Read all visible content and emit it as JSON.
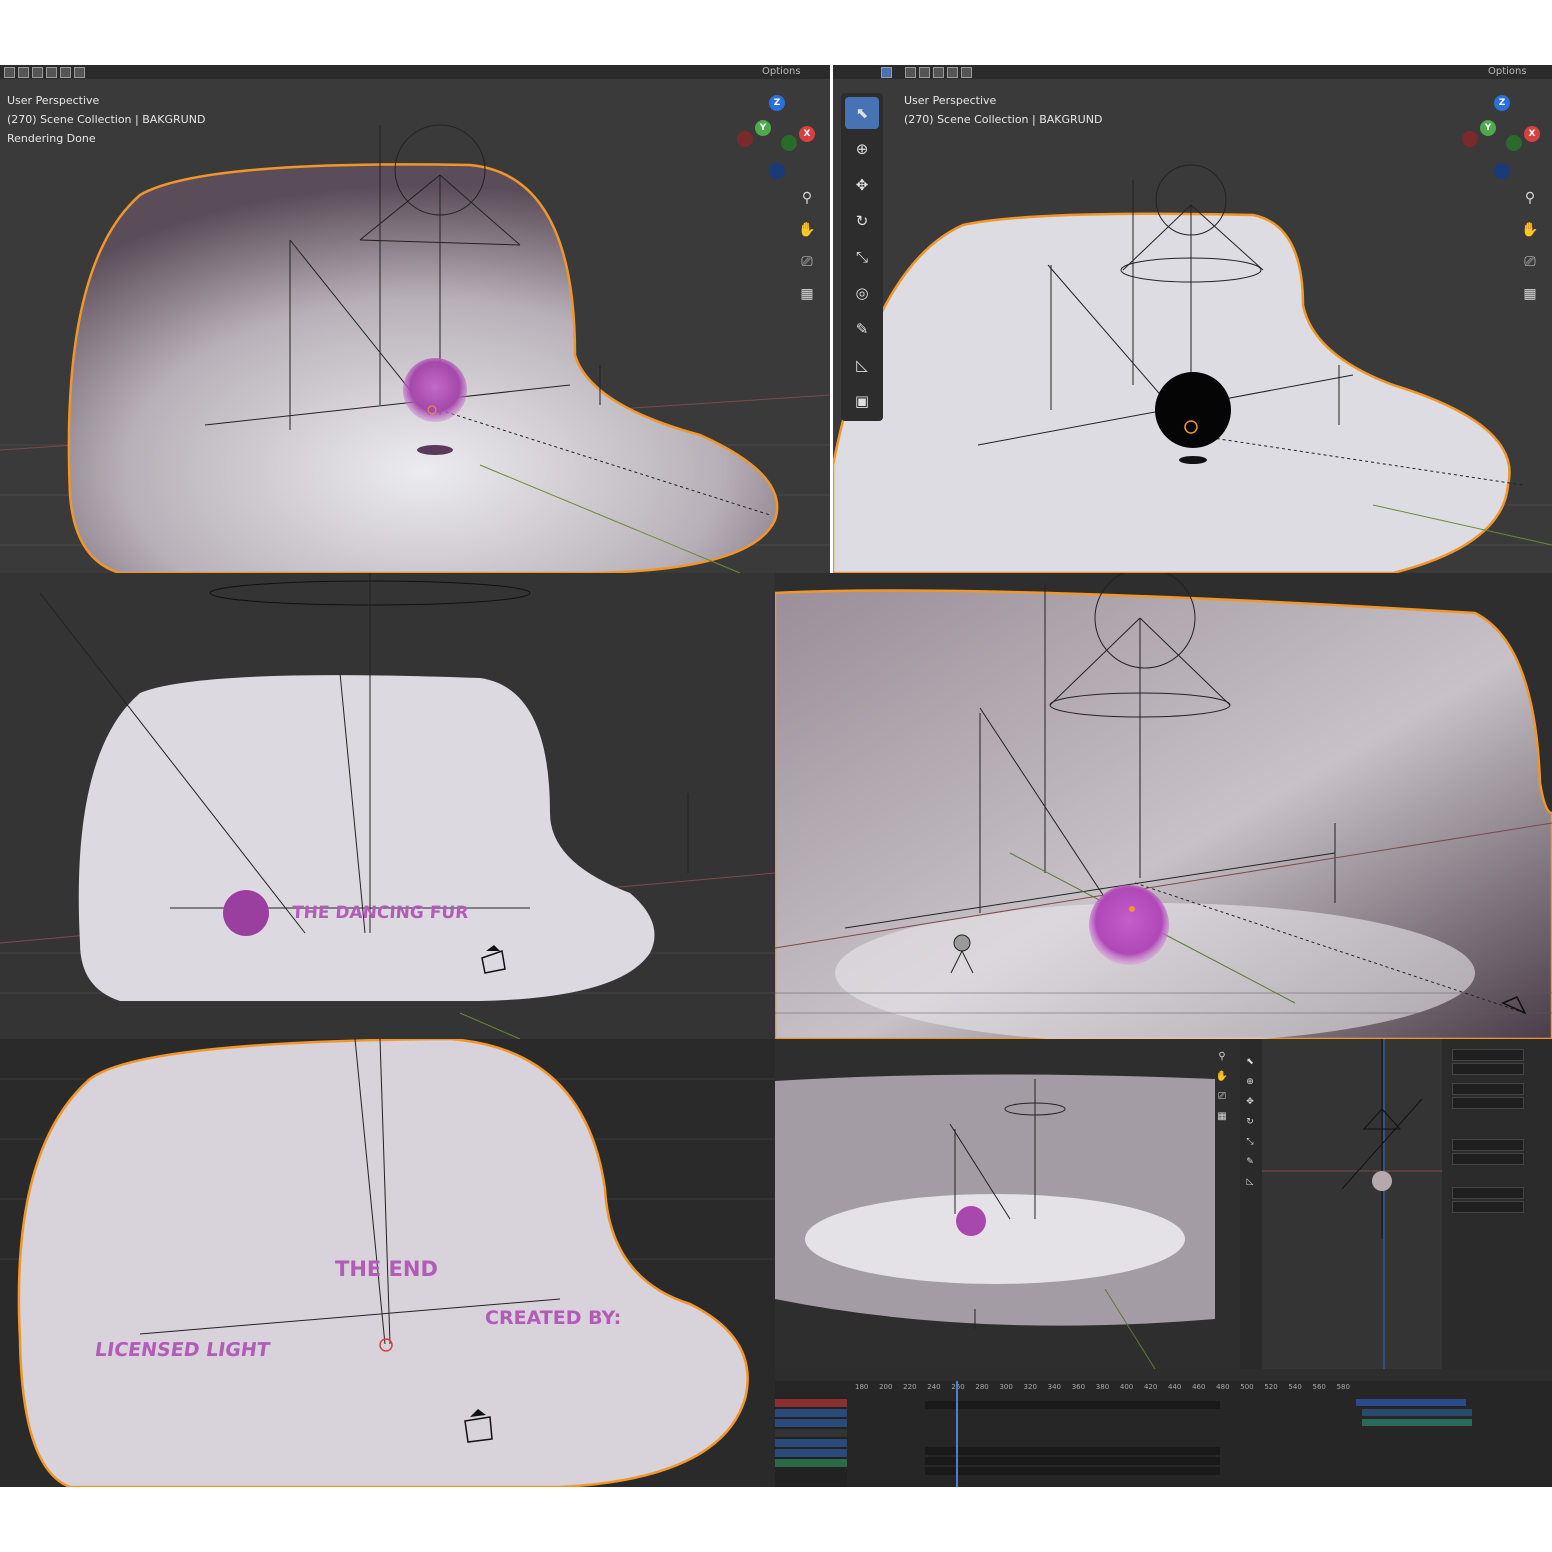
{
  "panel_top_left": {
    "options_label": "Options",
    "overlay_line1": "User Perspective",
    "overlay_line2": "(270) Scene Collection | BAKGRUND",
    "overlay_line3": "Rendering Done"
  },
  "panel_top_right": {
    "options_label": "Options",
    "overlay_line1": "User Perspective",
    "overlay_line2": "(270) Scene Collection | BAKGRUND"
  },
  "panel_mid_left": {
    "scene_text": "THE DANCING FUR"
  },
  "panel_bottom_left": {
    "scene_text_1": "THE END",
    "scene_text_2": "LICENSED LIGHT",
    "scene_text_3": "CREATED BY:"
  },
  "panel_bottom_right": {
    "timeline_frames": [
      "180",
      "200",
      "220",
      "240",
      "260",
      "280",
      "300",
      "320",
      "340",
      "360",
      "380",
      "400",
      "420",
      "440",
      "460",
      "480",
      "500",
      "520",
      "540",
      "560",
      "580"
    ]
  },
  "axes": {
    "z": "Z",
    "y": "Y",
    "x": "X"
  },
  "icons": [
    "zoom-icon",
    "hand-icon",
    "camera-icon",
    "grid-icon",
    "select-icon",
    "cursor-icon",
    "move-icon",
    "rotate-icon",
    "scale-icon",
    "transform-icon",
    "annotate-icon",
    "measure-icon",
    "add-cube-icon"
  ],
  "colors": {
    "outline": "#f0962a",
    "fur": "#b25cb8",
    "viewport_bg": "#3a3a3a",
    "active_tool": "#4772b3"
  }
}
